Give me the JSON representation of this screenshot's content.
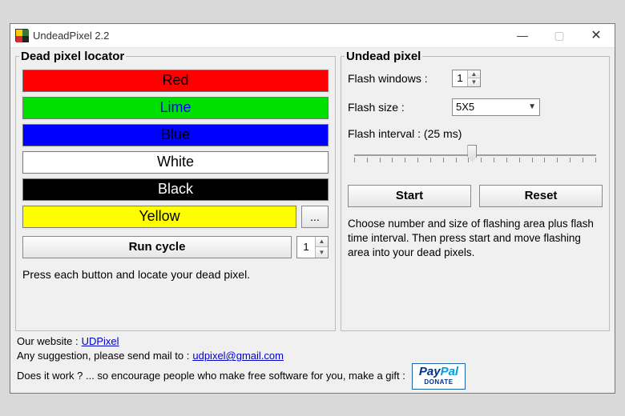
{
  "title": "UndeadPixel 2.2",
  "left": {
    "heading": "Dead pixel locator",
    "colors": {
      "red": "Red",
      "lime": "Lime",
      "blue": "Blue",
      "white": "White",
      "black": "Black",
      "yellow": "Yellow"
    },
    "more_label": "...",
    "run_cycle_label": "Run cycle",
    "run_cycle_value": "1",
    "hint": "Press each button and locate your dead pixel."
  },
  "right": {
    "heading": "Undead pixel",
    "flash_windows_label": "Flash windows :",
    "flash_windows_value": "1",
    "flash_size_label": "Flash size :",
    "flash_size_value": "5X5",
    "flash_interval_label": "Flash interval :  (25 ms)",
    "start_label": "Start",
    "reset_label": "Reset",
    "description": "Choose number and size of flashing area plus flash time interval. Then press start and move flashing area into your dead pixels."
  },
  "footer": {
    "website_label": "Our website :",
    "website_link": "UDPixel",
    "suggest_label": "Any suggestion, please send mail to :",
    "suggest_link": "udpixel@gmail.com",
    "donate_label": "Does it work ? ... so encourage people who make free software for you, make a gift :",
    "paypal_pay": "Pay",
    "paypal_pal": "Pal",
    "paypal_donate": "DONATE"
  }
}
